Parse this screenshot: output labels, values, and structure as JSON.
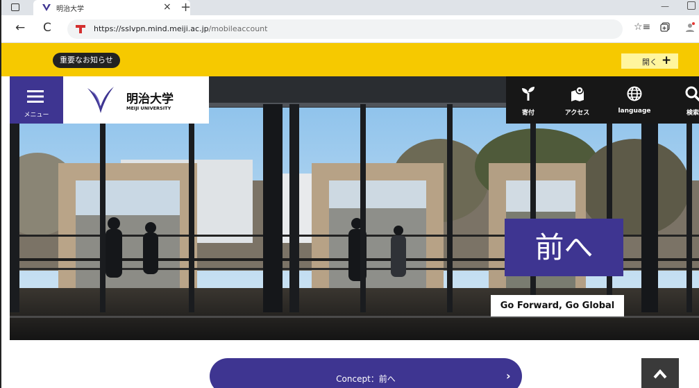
{
  "browser": {
    "tab_title": "明治大学",
    "tab_close": "×",
    "new_tab": "+",
    "minimize": "—",
    "url_host": "https://sslvpn.mind.meiji.ac.jp",
    "url_path": "/mobileaccount",
    "back": "←",
    "reload": "C",
    "favorites_icon": "star-list-icon"
  },
  "notice": {
    "pill_label": "重要なお知らせ",
    "open_label": "開く",
    "open_plus": "+",
    "bg_color": "#f6c900"
  },
  "header": {
    "menu_label": "メニュー",
    "logo_ja": "明治大学",
    "logo_en": "MEIJI UNIVERSITY",
    "accent_color": "#3e3591",
    "utility": [
      {
        "label": "寄付",
        "icon": "sprout-icon"
      },
      {
        "label": "アクセス",
        "icon": "map-pin-icon"
      },
      {
        "label": "language",
        "icon": "globe-icon"
      },
      {
        "label": "検索",
        "icon": "search-icon"
      }
    ]
  },
  "hero": {
    "catchphrase": "前へ",
    "tagline": "Go Forward, Go Global"
  },
  "main": {
    "concept_label": "Concept：前へ",
    "concept_chevron": "›",
    "totop_icon": "chevron-up-icon"
  }
}
